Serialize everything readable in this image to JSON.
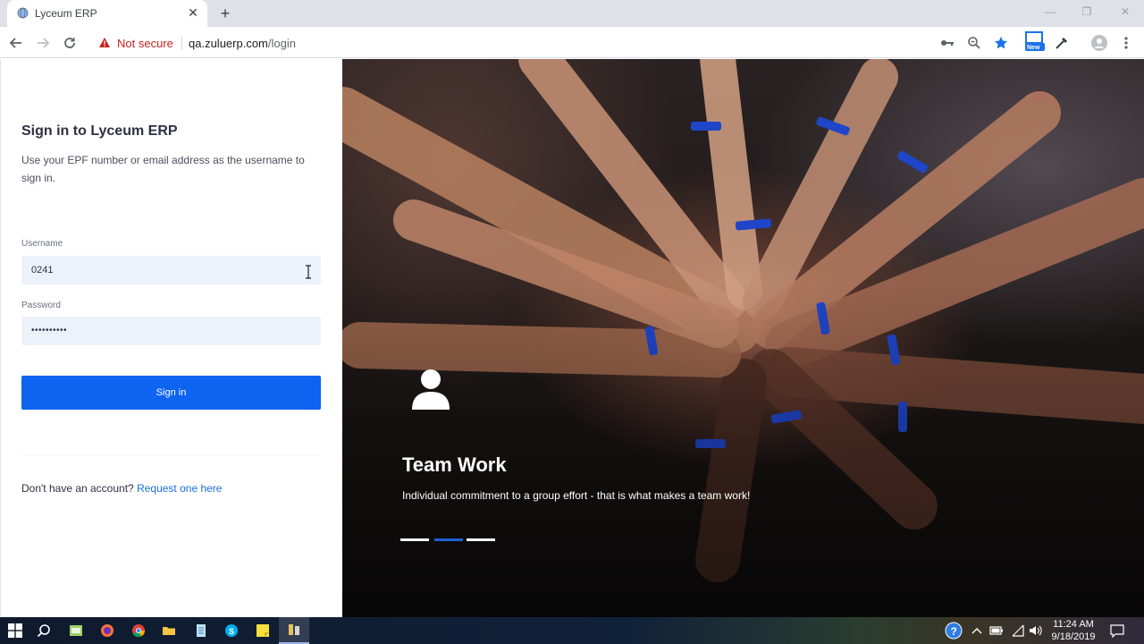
{
  "browser": {
    "tab_title": "Lyceum ERP",
    "tab_close": "✕",
    "new_tab": "+",
    "security_label": "Not secure",
    "url_host": "qa.zuluerp.com",
    "url_path": "/login",
    "extension_badge": "New"
  },
  "login": {
    "title": "Sign in to Lyceum ERP",
    "subtitle": "Use your EPF number or email address as the username to sign in.",
    "username_label": "Username",
    "username_value": "0241",
    "password_label": "Password",
    "password_value": "••••••••••",
    "signin_label": "Sign in",
    "no_account_text": "Don't have an account?",
    "request_link": "Request one here"
  },
  "hero": {
    "title": "Team Work",
    "text": "Individual commitment to a group effort - that is what makes a team work!",
    "slides": 3,
    "active_slide": 2
  },
  "taskbar": {
    "time": "11:24 AM",
    "date": "9/18/2019"
  },
  "colors": {
    "primary": "#0c64f0",
    "link": "#1a6fe0",
    "input_bg": "#edf2fa",
    "not_secure": "#c5221f"
  }
}
